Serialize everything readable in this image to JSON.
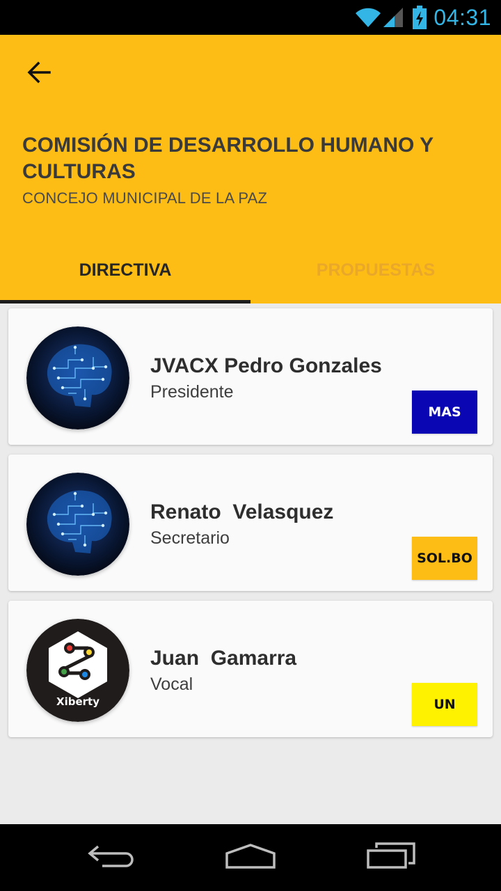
{
  "status_bar": {
    "time": "04:31",
    "icons": [
      "wifi-icon",
      "signal-icon",
      "battery-charging-icon"
    ],
    "accent_color": "#33b5e5"
  },
  "header": {
    "back_icon": "arrow-left-icon",
    "title": "COMISIÓN DE DESARROLLO HUMANO Y CULTURAS",
    "subtitle": "CONCEJO MUNICIPAL DE LA PAZ",
    "background_color": "#fdbd15"
  },
  "tabs": [
    {
      "label": "DIRECTIVA",
      "active": true
    },
    {
      "label": "PROPUESTAS",
      "active": false
    }
  ],
  "members": [
    {
      "name": "JVACX Pedro Gonzales",
      "role": "Presidente",
      "avatar": "brain-circuit-avatar",
      "party": {
        "label": "MAS",
        "bg": "#0a06b4",
        "fg": "#ffffff"
      }
    },
    {
      "name": "Renato  Velasquez",
      "role": "Secretario",
      "avatar": "brain-circuit-avatar",
      "party": {
        "label": "SOL.BO",
        "bg": "#fdbd15",
        "fg": "#111111"
      }
    },
    {
      "name": "Juan  Gamarra",
      "role": "Vocal",
      "avatar": "xiberty-logo-avatar",
      "avatar_text": "Xiberty",
      "party": {
        "label": "UN",
        "bg": "#fff200",
        "fg": "#111111"
      }
    }
  ],
  "nav_bar": {
    "buttons": [
      "back-nav-icon",
      "home-nav-icon",
      "recents-nav-icon"
    ]
  }
}
